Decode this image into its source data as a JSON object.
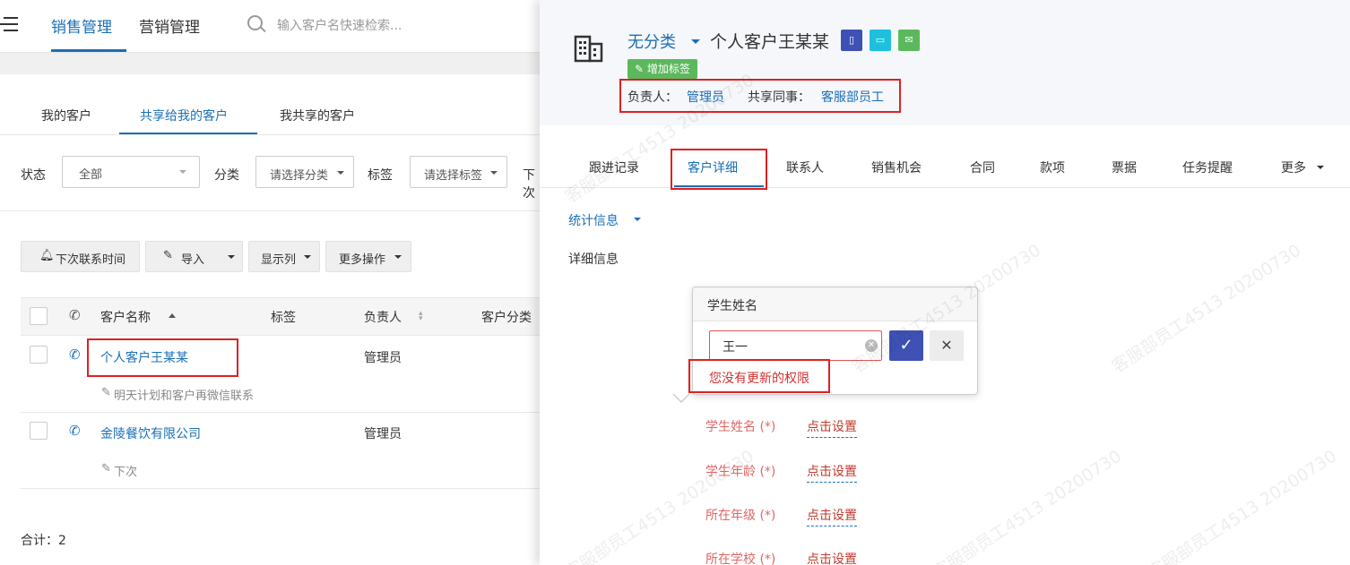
{
  "left": {
    "nav": {
      "sales": "销售管理",
      "marketing": "营销管理"
    },
    "search": {
      "placeholder": "输入客户名快速检索..."
    },
    "tabs": [
      "我的客户",
      "共享给我的客户",
      "我共享的客户"
    ],
    "filters": {
      "status_label": "状态",
      "status_value": "全部",
      "category_label": "分类",
      "category_value": "请选择分类",
      "tag_label": "标签",
      "tag_value": "请选择标签",
      "next_label": "下次"
    },
    "toolbar": {
      "next_contact": "下次联系时间",
      "import": "导入",
      "columns": "显示列",
      "more_ops": "更多操作"
    },
    "table": {
      "headers": {
        "name": "客户名称",
        "tags": "标签",
        "owner": "负责人",
        "category": "客户分类"
      },
      "rows": [
        {
          "name": "个人客户王某某",
          "owner": "管理员",
          "note": "明天计划和客户再微信联系"
        },
        {
          "name": "金陵餐饮有限公司",
          "owner": "管理员",
          "note": "下次"
        }
      ]
    },
    "total": "合计：2"
  },
  "right": {
    "category": "无分类",
    "customer_name": "个人客户王某某",
    "add_tag": "增加标签",
    "owner_label": "负责人：",
    "owner_value": "管理员",
    "share_label": "共享同事：",
    "share_value": "客服部员工",
    "tabs": [
      "跟进记录",
      "客户详细",
      "联系人",
      "销售机会",
      "合同",
      "款项",
      "票据",
      "任务提醒",
      "更多"
    ],
    "stats_link": "统计信息",
    "detail_title": "详细信息",
    "popover": {
      "title": "学生姓名",
      "input_value": "王一",
      "error": "您没有更新的权限"
    },
    "fields": [
      {
        "label": "学生姓名 (*)",
        "value": "点击设置"
      },
      {
        "label": "学生年龄 (*)",
        "value": "点击设置"
      },
      {
        "label": "所在年级 (*)",
        "value": "点击设置"
      },
      {
        "label": "所在学校 (*)",
        "value": "点击设置"
      }
    ],
    "watermark": "客服部员工4513 20200730"
  },
  "colors": {
    "accent": "#1a6fb5",
    "highlight": "#e02020",
    "add_tag": "#5cb85c",
    "field_label": "#e06666"
  }
}
